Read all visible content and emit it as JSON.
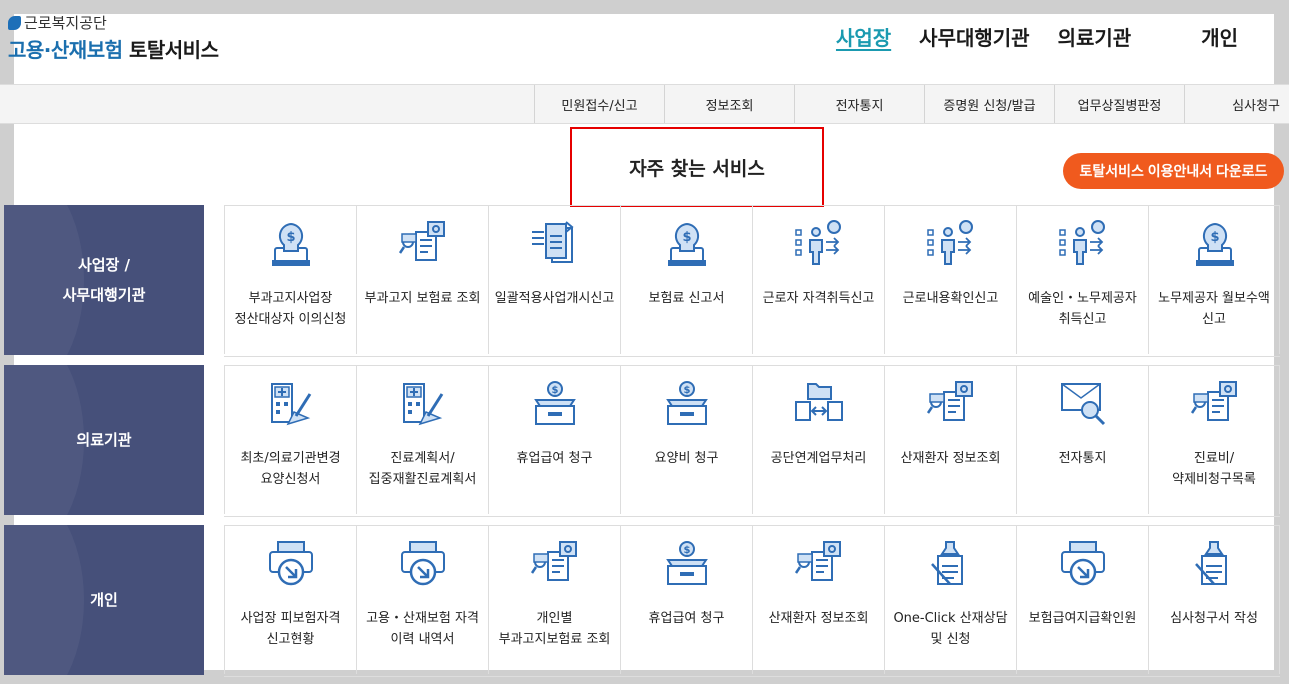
{
  "header": {
    "org_name": "근로복지공단",
    "title_blue": "고용·산재보험",
    "title_dark": "토탈서비스"
  },
  "gnb": [
    {
      "label": "사업장",
      "active": true
    },
    {
      "label": "사무대행기관"
    },
    {
      "label": "의료기관"
    },
    {
      "label": "개인"
    }
  ],
  "subnav": [
    {
      "label": "민원접수/신고"
    },
    {
      "label": "정보조회"
    },
    {
      "label": "전자통지"
    },
    {
      "label": "증명원 신청/발급"
    },
    {
      "label": "업무상질병판정"
    },
    {
      "label": "심사청구"
    }
  ],
  "favorites": {
    "title": "자주 찾는 서비스",
    "guide_download": "토탈서비스 이용안내서 다운로드"
  },
  "colors": {
    "navy": "#46507a",
    "accent": "#f05a1e",
    "icon_blue": "#2f6db5",
    "title_box": "#e60000",
    "gnb_active": "#1a9ab0"
  },
  "sections": [
    {
      "label_line1": "사업장 /",
      "label_line2": "사무대행기관",
      "items": [
        {
          "label": "부과고지사업장 정산대상자 이의신청",
          "icon": "money-bulb-icon"
        },
        {
          "label": "부과고지 보험료 조회",
          "icon": "document-search-icon"
        },
        {
          "label": "일괄적용사업개시신고",
          "icon": "document-stack-icon"
        },
        {
          "label": "보험료 신고서",
          "icon": "money-bulb-icon"
        },
        {
          "label": "근로자 자격취득신고",
          "icon": "person-chart-icon"
        },
        {
          "label": "근로내용확인신고",
          "icon": "person-chart-icon"
        },
        {
          "label": "예술인・노무제공자 취득신고",
          "icon": "person-chart-icon"
        },
        {
          "label": "노무제공자 월보수액 신고",
          "icon": "money-bulb-icon"
        }
      ]
    },
    {
      "label_line1": "의료기관",
      "label_line2": "",
      "items": [
        {
          "label": "최초/의료기관변경 요양신청서",
          "icon": "hospital-pen-icon"
        },
        {
          "label": "진료계획서/집중재활진료계획서",
          "icon": "hospital-pen-icon"
        },
        {
          "label": "휴업급여 청구",
          "icon": "money-box-icon"
        },
        {
          "label": "요양비 청구",
          "icon": "money-box-icon"
        },
        {
          "label": "공단연계업무처리",
          "icon": "folder-exchange-icon"
        },
        {
          "label": "산재환자 정보조회",
          "icon": "document-search-icon"
        },
        {
          "label": "전자통지",
          "icon": "mail-search-icon"
        },
        {
          "label": "진료비/약제비청구목록",
          "icon": "document-search-icon"
        }
      ]
    },
    {
      "label_line1": "개인",
      "label_line2": "",
      "items": [
        {
          "label": "사업장 피보험자격 신고현황",
          "icon": "printer-download-icon"
        },
        {
          "label": "고용・산재보험 자격 이력 내역서",
          "icon": "printer-download-icon"
        },
        {
          "label": "개인별 부과고지보험료 조회",
          "icon": "document-search-icon"
        },
        {
          "label": "휴업급여 청구",
          "icon": "money-box-icon"
        },
        {
          "label": "산재환자 정보조회",
          "icon": "document-search-icon"
        },
        {
          "label": "One-Click 산재상담 및 신청",
          "icon": "stamp-document-icon"
        },
        {
          "label": "보험급여지급확인원",
          "icon": "printer-download-icon"
        },
        {
          "label": "심사청구서 작성",
          "icon": "stamp-document-icon"
        }
      ]
    }
  ]
}
